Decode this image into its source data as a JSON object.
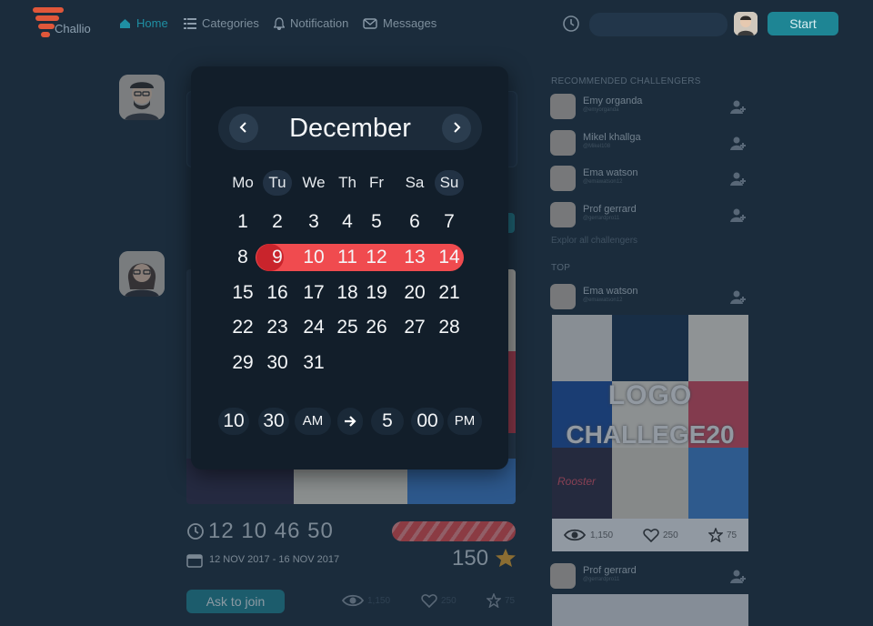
{
  "nav": {
    "logo_text": "Challio",
    "items": [
      {
        "label": "Home",
        "icon": "home-icon"
      },
      {
        "label": "Categories",
        "icon": "list-icon"
      },
      {
        "label": "Notification",
        "icon": "bell-icon"
      },
      {
        "label": "Messages",
        "icon": "mail-icon"
      }
    ],
    "start_label": "Start"
  },
  "calendar": {
    "month": "December",
    "weekdays": [
      "Mo",
      "Tu",
      "We",
      "Th",
      "Fr",
      "Sa",
      "Su"
    ],
    "highlighted_weekdays": [
      "Tu",
      "Su"
    ],
    "weeks": [
      [
        "1",
        "2",
        "3",
        "4",
        "5",
        "6",
        "7"
      ],
      [
        "8",
        "9",
        "10",
        "11",
        "12",
        "13",
        "14"
      ],
      [
        "15",
        "16",
        "17",
        "18",
        "19",
        "20",
        "21"
      ],
      [
        "22",
        "23",
        "24",
        "25",
        "26",
        "27",
        "28"
      ],
      [
        "29",
        "30",
        "31",
        "",
        "",
        "",
        ""
      ]
    ],
    "selected_range": [
      "9",
      "14"
    ],
    "start_hour": "10",
    "start_minute": "30",
    "start_period": "AM",
    "end_hour": "5",
    "end_minute": "00",
    "end_period": "PM",
    "range_color": "#f04b4f"
  },
  "challenge": {
    "countdown": "12 10 46 50",
    "dates": "12 NOV 2017 - 16 NOV 2017",
    "points": "150",
    "join_label": "Ask to join",
    "views": "1,150",
    "likes": "250",
    "stars": "75"
  },
  "sidebar": {
    "recommended_title": "RECOMMENDED CHALLENGERS",
    "challengers": [
      {
        "name": "Emy organda",
        "handle": "@emyorganda"
      },
      {
        "name": "Mikel khallga",
        "handle": "@Mikel108"
      },
      {
        "name": "Ema watson",
        "handle": "@emawatson12"
      },
      {
        "name": "Prof gerrard",
        "handle": "@gerrardpro11"
      }
    ],
    "explore_label": "Explor all challengers",
    "top_title": "TOP",
    "top_post": {
      "name": "Ema watson",
      "handle": "@emawatson12",
      "image_text_1": "LOGO",
      "image_text_2": "CHALLEGE20",
      "tile_text": "Rooster",
      "views": "1,150",
      "likes": "250",
      "stars": "75"
    },
    "next_post": {
      "name": "Prof gerrard",
      "handle": "@gerrardpro11"
    }
  }
}
